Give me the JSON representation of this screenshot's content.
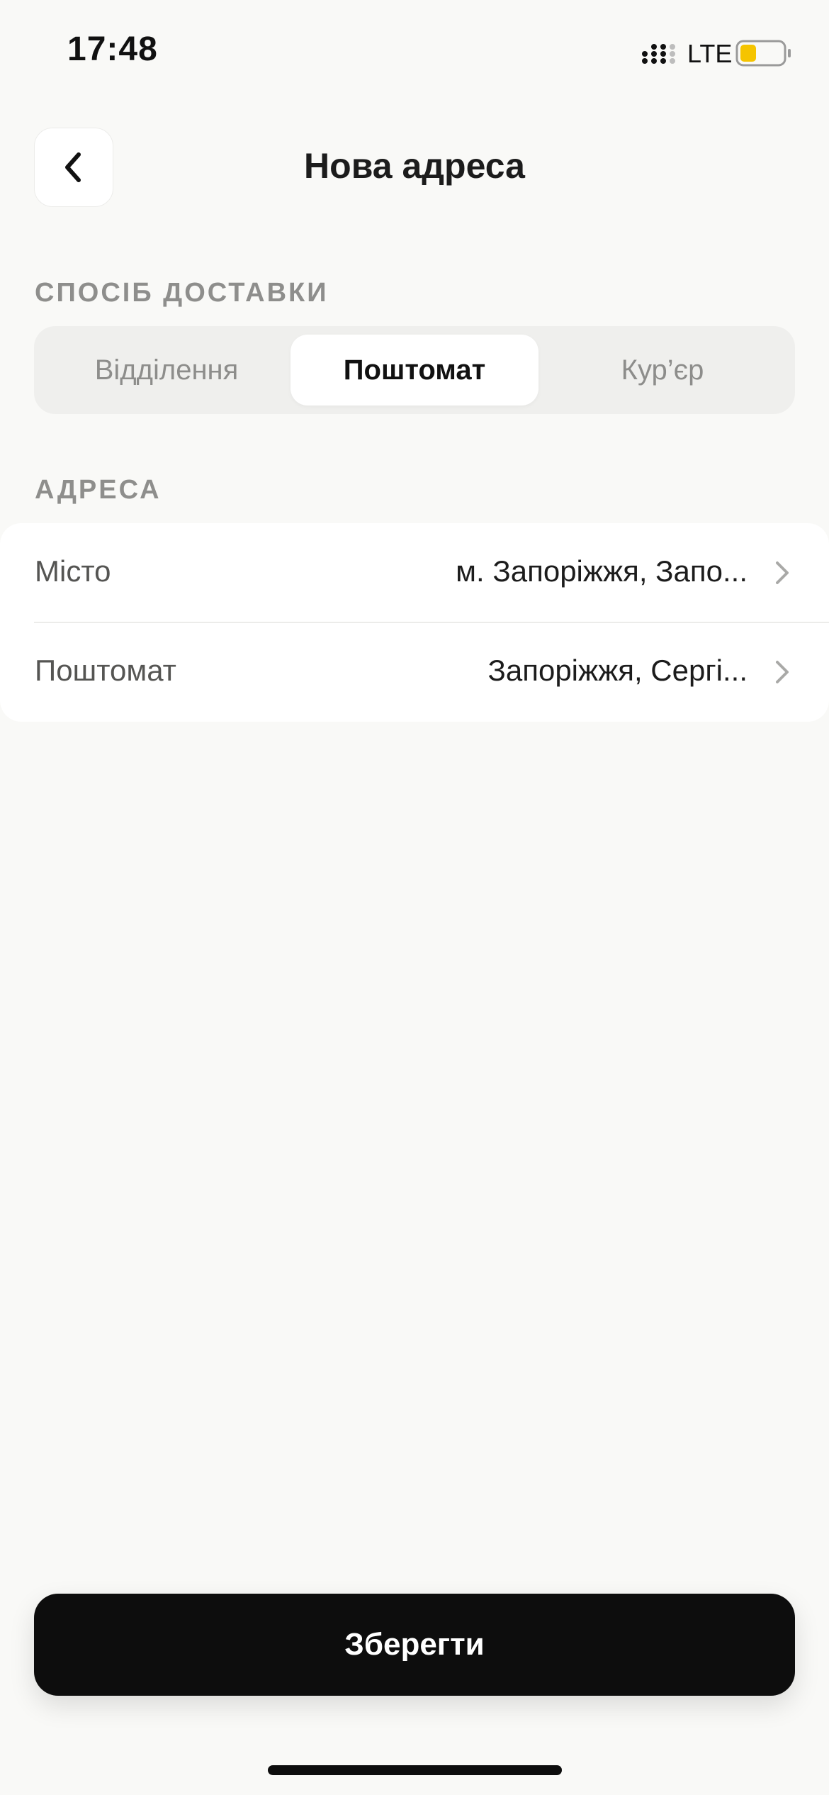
{
  "status_bar": {
    "time": "17:48",
    "network": "LTE",
    "battery_color": "#f5c400",
    "signal_icon": "cellular-signal-icon",
    "battery_icon": "battery-low-icon"
  },
  "header": {
    "title": "Нова адреса",
    "back_icon": "chevron-left-icon"
  },
  "delivery_section": {
    "label": "СПОСІБ ДОСТАВКИ",
    "options": [
      {
        "label": "Відділення",
        "selected": false
      },
      {
        "label": "Поштомат",
        "selected": true
      },
      {
        "label": "Кур’єр",
        "selected": false
      }
    ]
  },
  "address_section": {
    "label": "АДРЕСА",
    "rows": [
      {
        "label": "Місто",
        "value": "м. Запоріжжя, Запо..."
      },
      {
        "label": "Поштомат",
        "value": "Запоріжжя, Сергі..."
      }
    ]
  },
  "footer": {
    "save_label": "Зберегти",
    "accent": "#0d0d0d"
  }
}
